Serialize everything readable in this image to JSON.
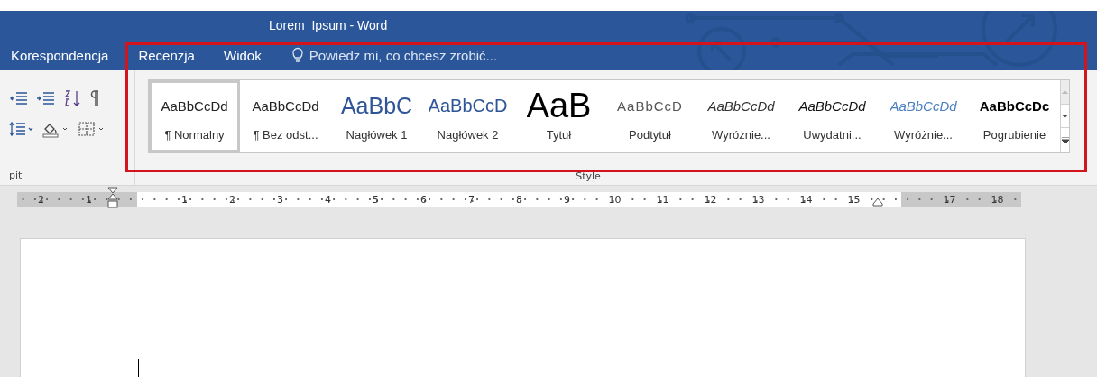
{
  "window": {
    "title": "Lorem_Ipsum - Word"
  },
  "tabs": [
    {
      "label": "Korespondencja",
      "selected": false
    },
    {
      "label": "Recenzja",
      "selected": false
    },
    {
      "label": "Widok",
      "selected": false
    }
  ],
  "tell_me": {
    "placeholder": "Powiedz mi, co chcesz zrobić..."
  },
  "paragraph_group": {
    "label": "pit"
  },
  "styles_group": {
    "label": "Style",
    "items": [
      {
        "preview": "AaBbCcDd",
        "label": "¶ Normalny",
        "kind": "normal",
        "selected": true
      },
      {
        "preview": "AaBbCcDd",
        "label": "¶ Bez odst...",
        "kind": "normal",
        "selected": false
      },
      {
        "preview": "AaBbC",
        "label": "Nagłówek 1",
        "kind": "heading1",
        "selected": false
      },
      {
        "preview": "AaBbCcD",
        "label": "Nagłówek 2",
        "kind": "heading2",
        "selected": false
      },
      {
        "preview": "AaB",
        "label": "Tytuł",
        "kind": "title",
        "selected": false
      },
      {
        "preview": "AaBbCcD",
        "label": "Podtytuł",
        "kind": "subtitle",
        "selected": false
      },
      {
        "preview": "AaBbCcDd",
        "label": "Wyróżnie...",
        "kind": "emphasis",
        "selected": false
      },
      {
        "preview": "AaBbCcDd",
        "label": "Uwydatni...",
        "kind": "intense",
        "selected": false
      },
      {
        "preview": "AaBbCcDd",
        "label": "Wyróżnie...",
        "kind": "intense_emphasis",
        "selected": false
      },
      {
        "preview": "AaBbCcDc",
        "label": "Pogrubienie",
        "kind": "strong",
        "selected": false
      }
    ]
  },
  "ruler": {
    "left_margin_labels": [
      "2",
      "1"
    ],
    "text_labels": [
      "1",
      "2",
      "3",
      "4",
      "5",
      "6",
      "7",
      "8",
      "9",
      "10",
      "11",
      "12",
      "13",
      "14",
      "15"
    ],
    "right_margin_labels": [
      "17",
      "18"
    ]
  }
}
